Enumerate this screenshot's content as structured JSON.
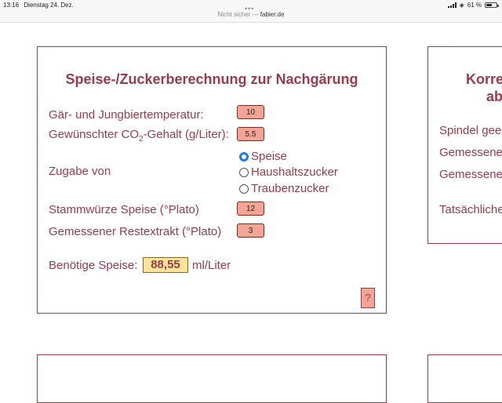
{
  "status_bar": {
    "time": "13:16",
    "date": "Dienstag 24. Dez.",
    "battery_percent": "61 %",
    "battery_level": 0.61
  },
  "browser": {
    "url_prefix": "Nicht sicher — ",
    "url_domain": "fabier.de"
  },
  "calculator": {
    "title": "Speise-/Zuckerberechnung zur Nachgärung",
    "temperature_label": "Gär- und Jungbiertemperatur:",
    "temperature_value": "10",
    "co2_label_pre": "Gewünschter CO",
    "co2_label_sub": "2",
    "co2_label_post": "-Gehalt (g/Liter):",
    "co2_value": "5.5",
    "addition_label": "Zugabe von",
    "options": [
      {
        "label": "Speise",
        "checked": true
      },
      {
        "label": "Haushaltszucker",
        "checked": false
      },
      {
        "label": "Traubenzucker",
        "checked": false
      }
    ],
    "wort_label": "Stammwürze Speise (°Plato)",
    "wort_value": "12",
    "residual_label": "Gemessener Restextrakt (°Plato)",
    "residual_value": "3",
    "result_label": "Benötige Speise:",
    "result_value": "88,55",
    "result_unit": "ml/Liter",
    "help_label": "?"
  },
  "right_card": {
    "title_line1": "Korre",
    "title_line2": "ab",
    "rows": [
      "Spindel gee",
      "Gemessener",
      "Gemessener",
      "Tatsächliche"
    ]
  }
}
